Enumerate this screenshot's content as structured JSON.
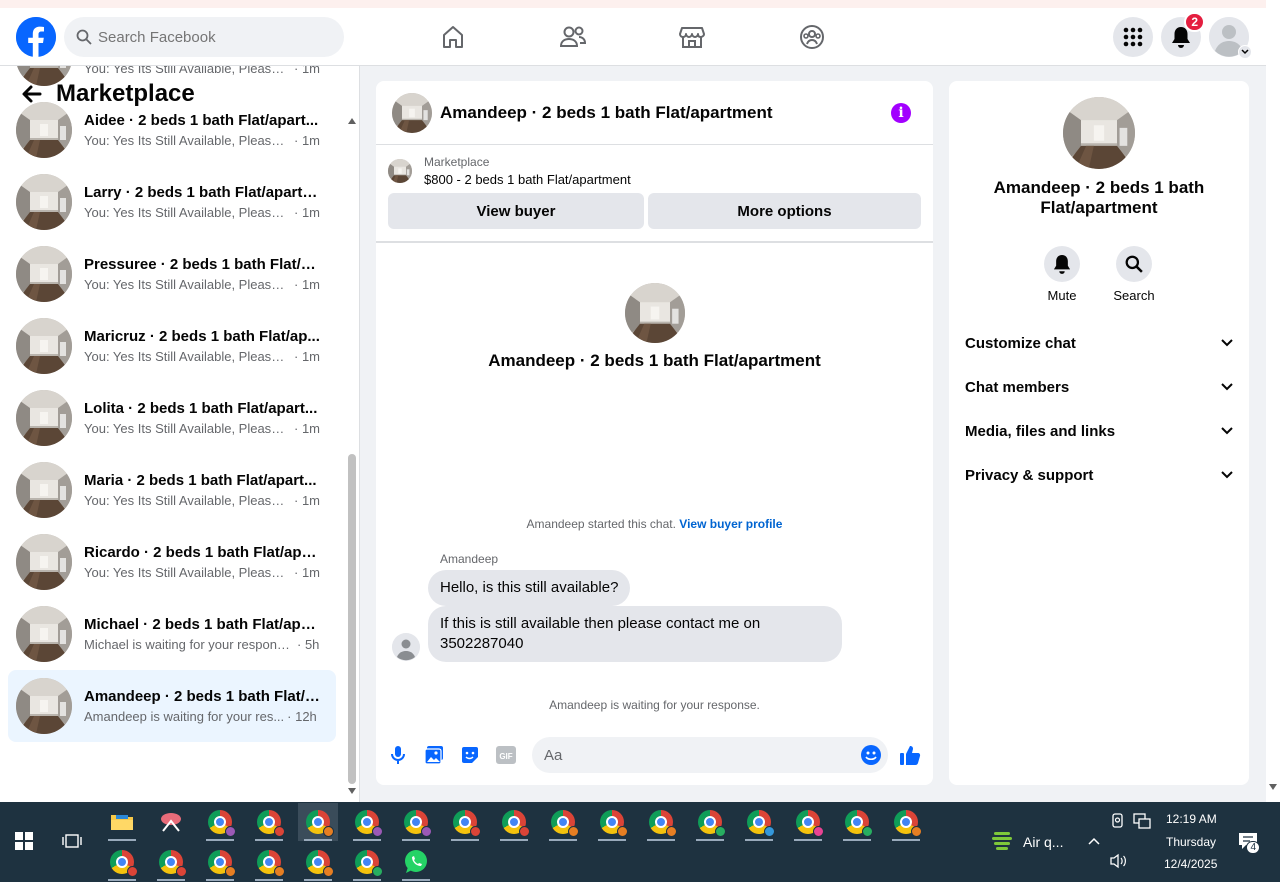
{
  "header": {
    "search_placeholder": "Search Facebook",
    "notification_count": "2",
    "colors": {
      "brand": "#0866ff",
      "badge": "#e41e3f"
    },
    "icons": [
      "home-icon",
      "friends-icon",
      "marketplace-icon",
      "groups-icon",
      "menu-grid-icon",
      "bell-icon",
      "profile-avatar"
    ]
  },
  "sidebar": {
    "title": "Marketplace",
    "conversations": [
      {
        "title": "...",
        "preview": "You: Yes Its Still Available, Please S...",
        "time": "· 1m"
      },
      {
        "title": "Aidee · 2 beds 1 bath Flat/apart...",
        "preview": "You: Yes Its Still Available, Please S...",
        "time": "· 1m"
      },
      {
        "title": "Larry · 2 beds 1 bath Flat/apartm...",
        "preview": "You: Yes Its Still Available, Please S...",
        "time": "· 1m"
      },
      {
        "title": "Pressuree · 2 beds 1 bath Flat/ap...",
        "preview": "You: Yes Its Still Available, Please S...",
        "time": "· 1m"
      },
      {
        "title": "Maricruz · 2 beds 1 bath Flat/ap...",
        "preview": "You: Yes Its Still Available, Please S...",
        "time": "· 1m"
      },
      {
        "title": "Lolita · 2 beds 1 bath Flat/apart...",
        "preview": "You: Yes Its Still Available, Please S...",
        "time": "· 1m"
      },
      {
        "title": "Maria · 2 beds 1 bath Flat/apart...",
        "preview": "You: Yes Its Still Available, Please S...",
        "time": "· 1m"
      },
      {
        "title": "Ricardo · 2 beds 1 bath Flat/apar...",
        "preview": "You: Yes Its Still Available, Please S...",
        "time": "· 1m"
      },
      {
        "title": "Michael · 2 beds 1 bath Flat/apar...",
        "preview": "Michael is waiting for your response.",
        "time": "· 5h"
      },
      {
        "title": "Amandeep · 2 beds 1 bath Flat/a...",
        "preview": "Amandeep is waiting for your res...",
        "time": "· 12h"
      }
    ]
  },
  "chat": {
    "title": "Amandeep · 2 beds 1 bath Flat/apartment",
    "marketplace_label": "Marketplace",
    "listing": "$800 - 2 beds 1 bath Flat/apartment",
    "view_buyer": "View buyer",
    "more_options": "More options",
    "intro_name": "Amandeep · 2 beds 1 bath Flat/apartment",
    "started_text": "Amandeep started this chat.",
    "view_profile": "View buyer profile",
    "sender": "Amandeep",
    "messages": [
      "Hello, is this still available?",
      "If this is still available then please contact me on 3502287040"
    ],
    "waiting": "Amandeep is waiting for your response.",
    "composer_placeholder": "Aa",
    "accent": "#0866ff"
  },
  "details": {
    "name": "Amandeep · 2 beds 1 bath Flat/apartment",
    "mute": "Mute",
    "search": "Search",
    "sections": [
      "Customize chat",
      "Chat members",
      "Media, files and links",
      "Privacy & support"
    ]
  },
  "taskbar": {
    "weather": "Air q...",
    "time": "12:19 AM",
    "day": "Thursday",
    "date": "12/4/2025",
    "notif_count": "4"
  }
}
